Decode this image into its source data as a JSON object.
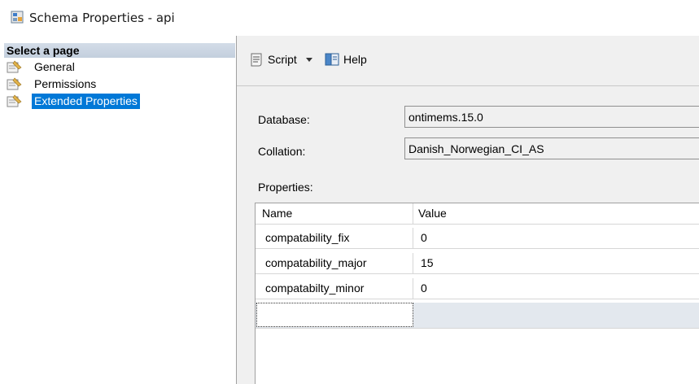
{
  "window": {
    "title": "Schema Properties - api"
  },
  "sidebar": {
    "header": "Select a page",
    "items": [
      {
        "label": "General"
      },
      {
        "label": "Permissions"
      },
      {
        "label": "Extended Properties",
        "selected": true
      }
    ]
  },
  "toolbar": {
    "script_label": "Script",
    "help_label": "Help"
  },
  "form": {
    "database_label": "Database:",
    "database_value": "ontimems.15.0",
    "collation_label": "Collation:",
    "collation_value": "Danish_Norwegian_CI_AS",
    "properties_label": "Properties:"
  },
  "grid": {
    "columns": [
      "Name",
      "Value"
    ],
    "rows": [
      {
        "name": "compatability_fix",
        "value": "0"
      },
      {
        "name": "compatability_major",
        "value": "15"
      },
      {
        "name": "compatabilty_minor",
        "value": "0"
      }
    ]
  },
  "colors": {
    "selection": "#0078d7",
    "pane_bg": "#f0f0f0",
    "header_bg": "#c3cfdd"
  },
  "icons": [
    "schema-properties-icon",
    "page-icon",
    "script-icon",
    "dropdown-arrow-icon",
    "help-icon"
  ]
}
